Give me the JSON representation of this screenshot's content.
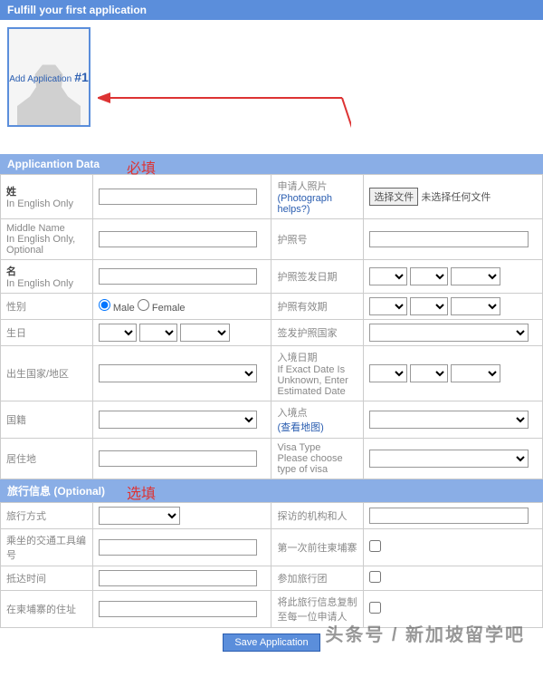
{
  "header": {
    "title": "Fulfill your first application"
  },
  "photo": {
    "label": "Add Application",
    "num": "#1"
  },
  "sections": {
    "app_data": {
      "title": "Applicantion Data",
      "annotation": "必填"
    },
    "travel": {
      "title": "旅行信息 (Optional)",
      "annotation": "选填"
    }
  },
  "labels": {
    "surname": "姓",
    "surname_hint": "In English Only",
    "photo": "申请人照片",
    "photo_help": "(Photograph helps?)",
    "file_btn": "选择文件",
    "file_status": "未选择任何文件",
    "middle": "Middle Name",
    "middle_hint": "In English Only, Optional",
    "passport_no": "护照号",
    "given": "名",
    "given_hint": "In English Only",
    "passport_issue": "护照签发日期",
    "gender": "性别",
    "male": "Male",
    "female": "Female",
    "passport_expiry": "护照有效期",
    "dob": "生日",
    "issue_country": "签发护照国家",
    "birth_place": "出生国家/地区",
    "entry_date": "入境日期",
    "entry_date_hint": "If Exact Date Is Unknown, Enter Estimated Date",
    "nationality": "国籍",
    "entry_point": "入境点",
    "entry_point_help": "(查看地图)",
    "residence": "居住地",
    "visa_type": "Visa Type",
    "visa_type_hint": "Please choose type of visa",
    "travel_method": "旅行方式",
    "visit_org": "探访的机构和人",
    "vehicle_no": "乘坐的交通工具编号",
    "first_visit": "第一次前往柬埔寨",
    "arrival_time": "抵达时间",
    "tour_group": "参加旅行团",
    "address_kh": "在柬埔寨的住址",
    "copy_info": "将此旅行信息复制至每一位申请人"
  },
  "buttons": {
    "save": "Save Application"
  },
  "watermark": "头条号 / 新加坡留学吧"
}
